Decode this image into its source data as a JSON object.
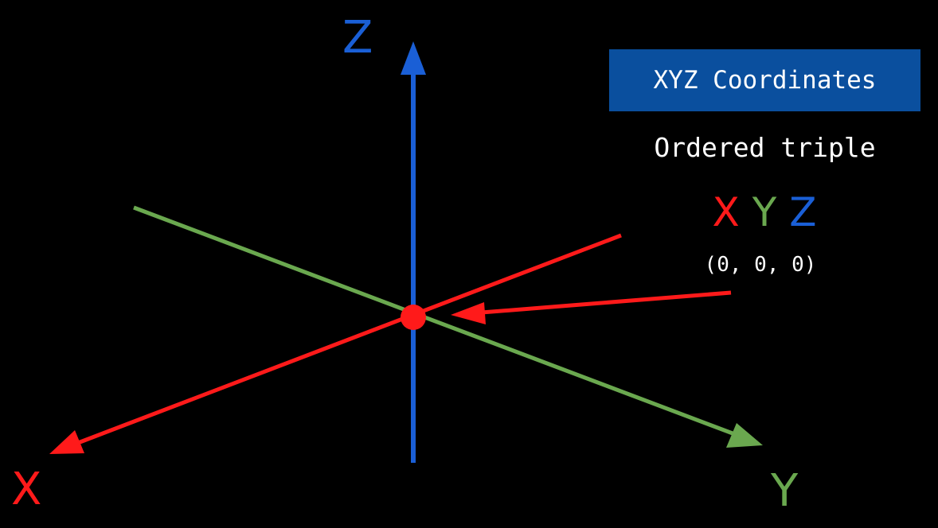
{
  "colors": {
    "background": "#000000",
    "x_axis": "#ff1a1a",
    "y_axis": "#6aa84f",
    "z_axis": "#1a5fd6",
    "title_box": "#0a4f9e",
    "text": "#ffffff"
  },
  "axes": {
    "x_label": "X",
    "y_label": "Y",
    "z_label": "Z"
  },
  "panel": {
    "title": "XYZ Coordinates",
    "subtitle": "Ordered triple",
    "triple": {
      "x": "X",
      "y": "Y",
      "z": "Z"
    },
    "origin_text": "(0, 0, 0)"
  },
  "icons": {
    "origin_marker": "origin-point-icon",
    "pointer": "arrow-icon"
  }
}
